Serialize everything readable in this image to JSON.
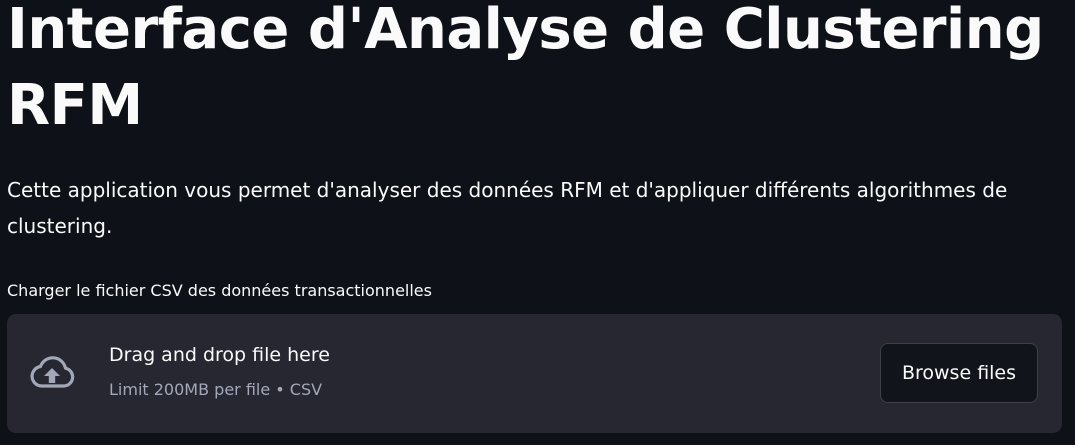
{
  "header": {
    "title": "Interface d'Analyse de Clustering RFM"
  },
  "intro": {
    "text": "Cette application vous permet d'analyser des données RFM et d'appliquer différents algorithmes de clustering."
  },
  "uploader": {
    "label": "Charger le fichier CSV des données transactionnelles",
    "drop_text": "Drag and drop file here",
    "limit_text": "Limit 200MB per file • CSV",
    "browse_label": "Browse files",
    "icon": "cloud-upload-icon"
  },
  "colors": {
    "background": "#0e1117",
    "dropzone": "#262730",
    "text": "#fafafa",
    "muted_text": "#a3a8b8",
    "button_bg": "#12141b",
    "button_border": "#3d404a"
  }
}
